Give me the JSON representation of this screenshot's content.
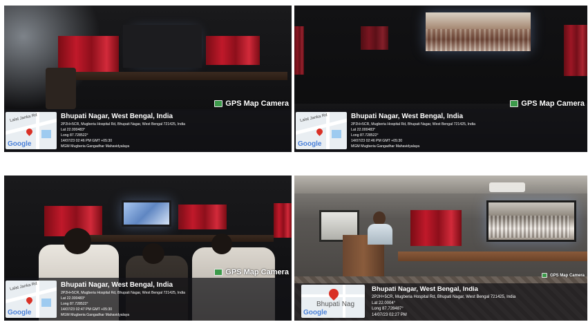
{
  "photos": [
    {
      "watermark": "GPS Map Camera",
      "map_street": "Lalat Janka Rd",
      "map_logo": "Google",
      "city": "Bhupati Nagar, West Bengal, India",
      "address": "2P2H+5CR, Mugberia Hospital Rd, Bhupati Nagar, West Bengal 721425, India",
      "lat": "Lat 22.000483°",
      "long": "Long 87.728522°",
      "datetime": "14/07/23 02:46 PM GMT +05:30",
      "place": "MGM Mugberia Gangadhar Mahavidyalaya"
    },
    {
      "watermark": "GPS Map Camera",
      "map_street": "Lalat Janka Rd",
      "map_logo": "Google",
      "city": "Bhupati Nagar, West Bengal, India",
      "address": "2P2H+5CR, Mugberia Hospital Rd, Bhupati Nagar, West Bengal 721425, India",
      "lat": "Lat 22.000483°",
      "long": "Long 87.728522°",
      "datetime": "14/07/23 02:46 PM GMT +05:30",
      "place": "MGM Mugberia Gangadhar Mahavidyalaya"
    },
    {
      "watermark": "GPS Map Camera",
      "map_street": "Lalat Janka Rd",
      "map_logo": "Google",
      "city": "Bhupati Nagar, West Bengal, India",
      "address": "2P2H+5CR, Mugberia Hospital Rd, Bhupati Nagar, West Bengal 721425, India",
      "lat": "Lat 22.000483°",
      "long": "Long 87.728522°",
      "datetime": "14/07/23 02:47 PM GMT +05:30",
      "place": "MGM Mugberia Gangadhar Mahavidyalaya"
    },
    {
      "watermark": "GPS Map Camera",
      "map_label": "Bhupati Nag",
      "map_logo": "Google",
      "city": "Bhupati Nagar, West Bengal, India",
      "address": "2P2H+5CR, Mugberia Hospital Rd, Bhupati Nagar, West Bengal 721425, India",
      "lat": "Lat 22.0004°",
      "long": "Long 87.728487°",
      "datetime": "14/07/23 02:27 PM"
    }
  ]
}
